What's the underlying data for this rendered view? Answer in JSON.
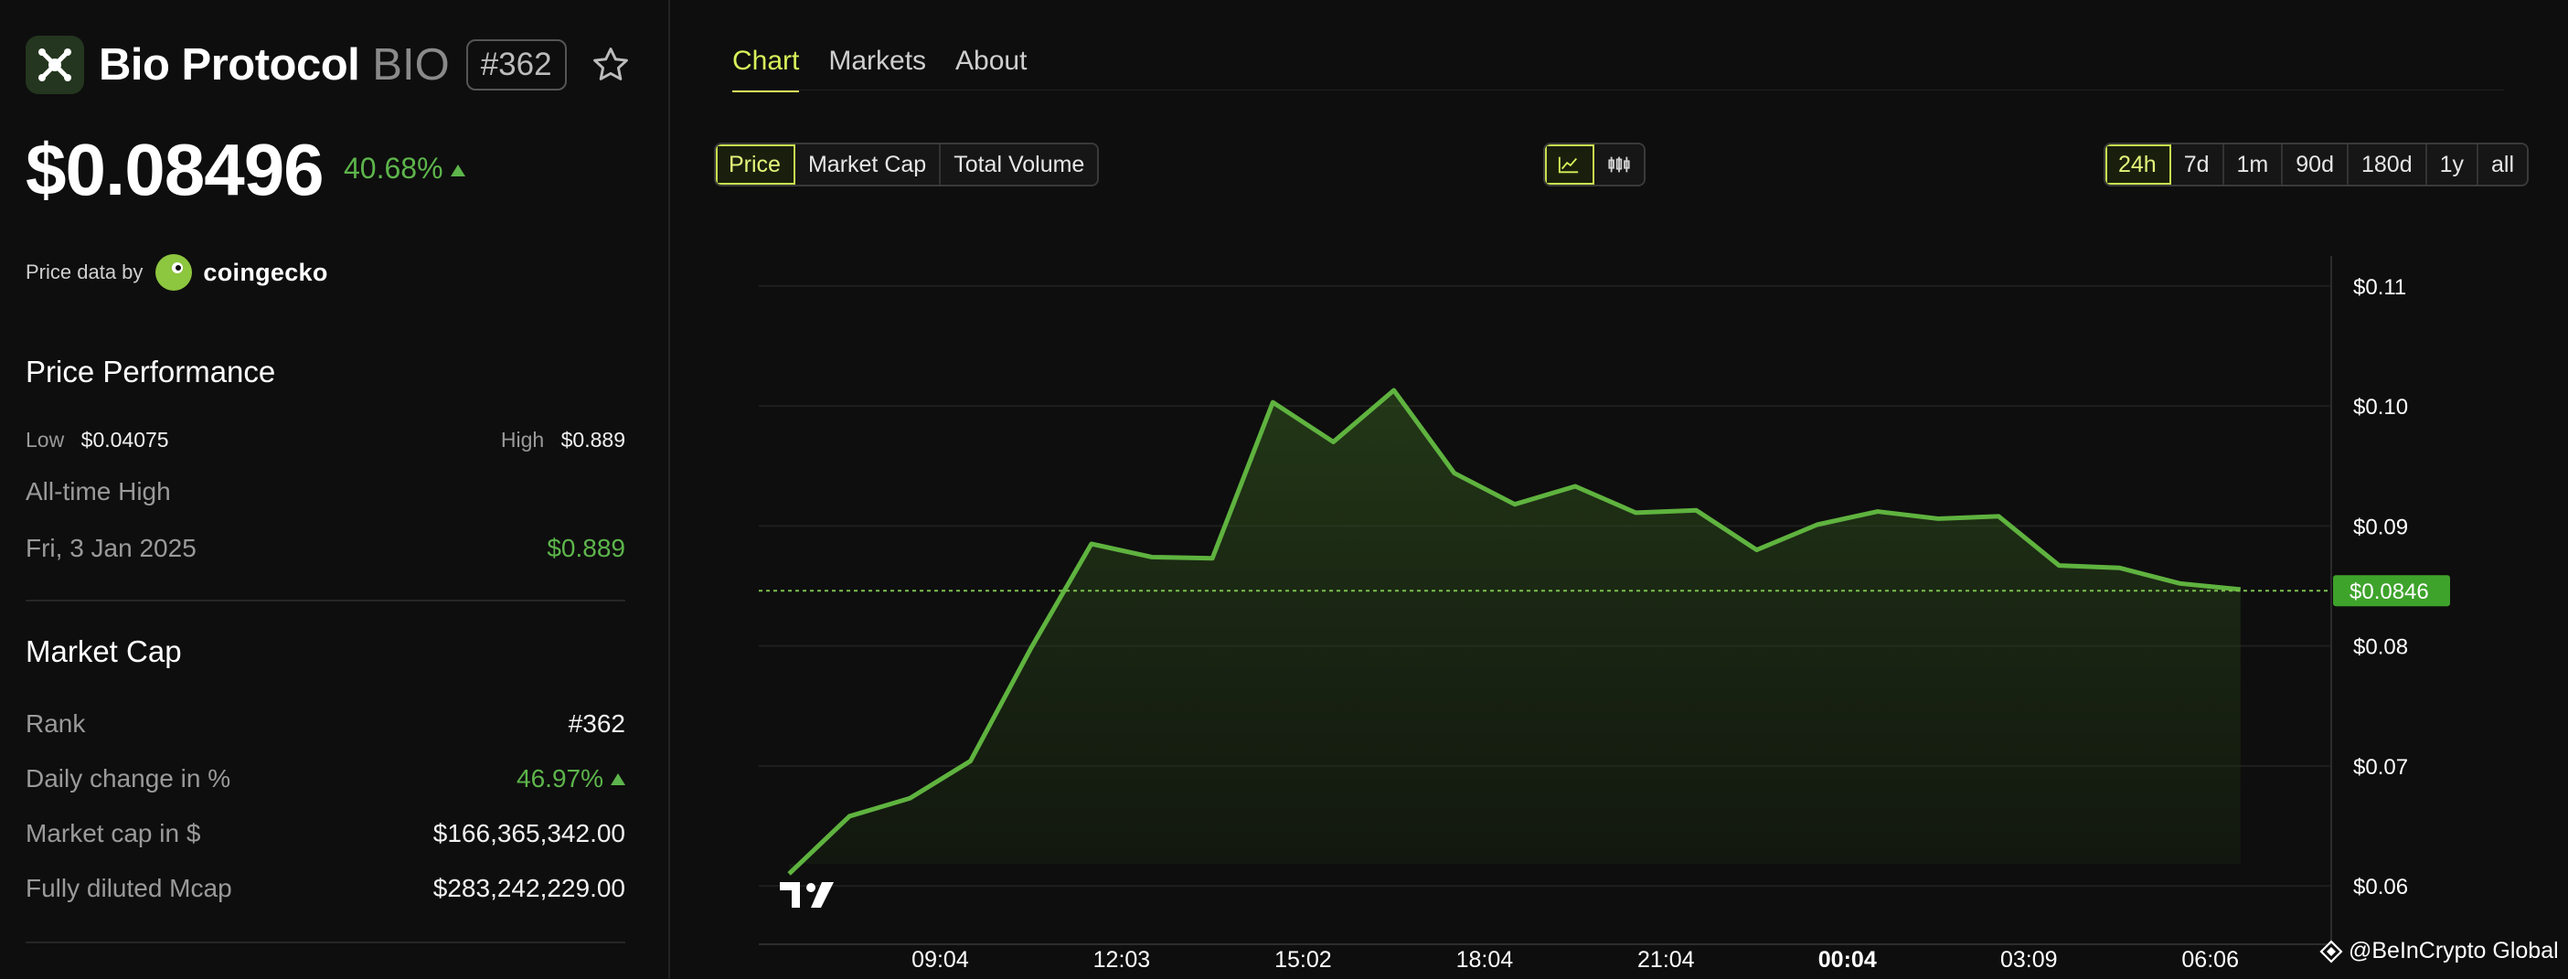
{
  "coin": {
    "name": "Bio Protocol",
    "symbol": "BIO",
    "rank_badge": "#362",
    "price": "$0.08496",
    "change": "40.68%",
    "price_data_label": "Price data by",
    "price_data_source": "coingecko"
  },
  "performance": {
    "title": "Price Performance",
    "low_label": "Low",
    "low_value": "$0.04075",
    "high_label": "High",
    "high_value": "$0.889",
    "ath_label": "All-time High",
    "ath_date": "Fri, 3 Jan 2025",
    "ath_value": "$0.889"
  },
  "market_cap": {
    "title": "Market Cap",
    "rows": [
      {
        "label": "Rank",
        "value": "#362"
      },
      {
        "label": "Daily change in %",
        "value": "46.97%"
      },
      {
        "label": "Market cap in $",
        "value": "$166,365,342.00"
      },
      {
        "label": "Fully diluted Mcap",
        "value": "$283,242,229.00"
      }
    ]
  },
  "tabs": [
    "Chart",
    "Markets",
    "About"
  ],
  "metric_buttons": [
    "Price",
    "Market Cap",
    "Total Volume"
  ],
  "range_buttons": [
    "24h",
    "7d",
    "1m",
    "90d",
    "180d",
    "1y",
    "all"
  ],
  "icons": {
    "logo": "bio-protocol-logo-icon",
    "star": "star-icon",
    "line_chart": "line-chart-icon",
    "candles": "candlestick-icon",
    "tradingview": "tradingview-logo-icon",
    "watermark": "beincrypto-icon"
  },
  "colors": {
    "accent": "#d8f05a",
    "up": "#5db54b",
    "line": "#5fb33f",
    "background": "#0e0e0e"
  },
  "watermark": "@BeInCrypto Global",
  "chart_data": {
    "type": "area",
    "y_tick_labels": [
      "$0.11",
      "$0.10",
      "$0.09",
      "$0.08",
      "$0.07",
      "$0.06"
    ],
    "y_ticks": [
      0.11,
      0.1,
      0.09,
      0.08,
      0.07,
      0.06
    ],
    "ylim": [
      0.0565,
      0.1125
    ],
    "x_tick_labels": [
      "09:04",
      "12:03",
      "15:02",
      "18:04",
      "21:04",
      "00:04",
      "03:09",
      "06:06"
    ],
    "x_tick_hours": [
      3,
      6,
      9,
      12,
      15,
      18,
      21,
      24
    ],
    "x_tick_bold": [
      false,
      false,
      false,
      false,
      false,
      true,
      false,
      false
    ],
    "xlim_hours": [
      0,
      26
    ],
    "current_price_label": "$0.0846",
    "current_price": 0.0846,
    "grid": true,
    "series": [
      {
        "x_hours": [
          0.5,
          1.5,
          2.5,
          3.5,
          4.5,
          5.5,
          6.5,
          7.5,
          8.5,
          9.5,
          10.5,
          11.5,
          12.5,
          13.5,
          14.5,
          15.5,
          16.5,
          17.5,
          18.5,
          19.5,
          20.5,
          21.5,
          22.5,
          23.5,
          24.5
        ],
        "values": [
          0.061,
          0.0658,
          0.0673,
          0.0704,
          0.0798,
          0.0885,
          0.0874,
          0.0873,
          0.1003,
          0.097,
          0.1013,
          0.0944,
          0.0918,
          0.0933,
          0.0911,
          0.0913,
          0.088,
          0.0901,
          0.0912,
          0.0906,
          0.0908,
          0.0867,
          0.0865,
          0.0852,
          0.0847
        ]
      }
    ]
  }
}
